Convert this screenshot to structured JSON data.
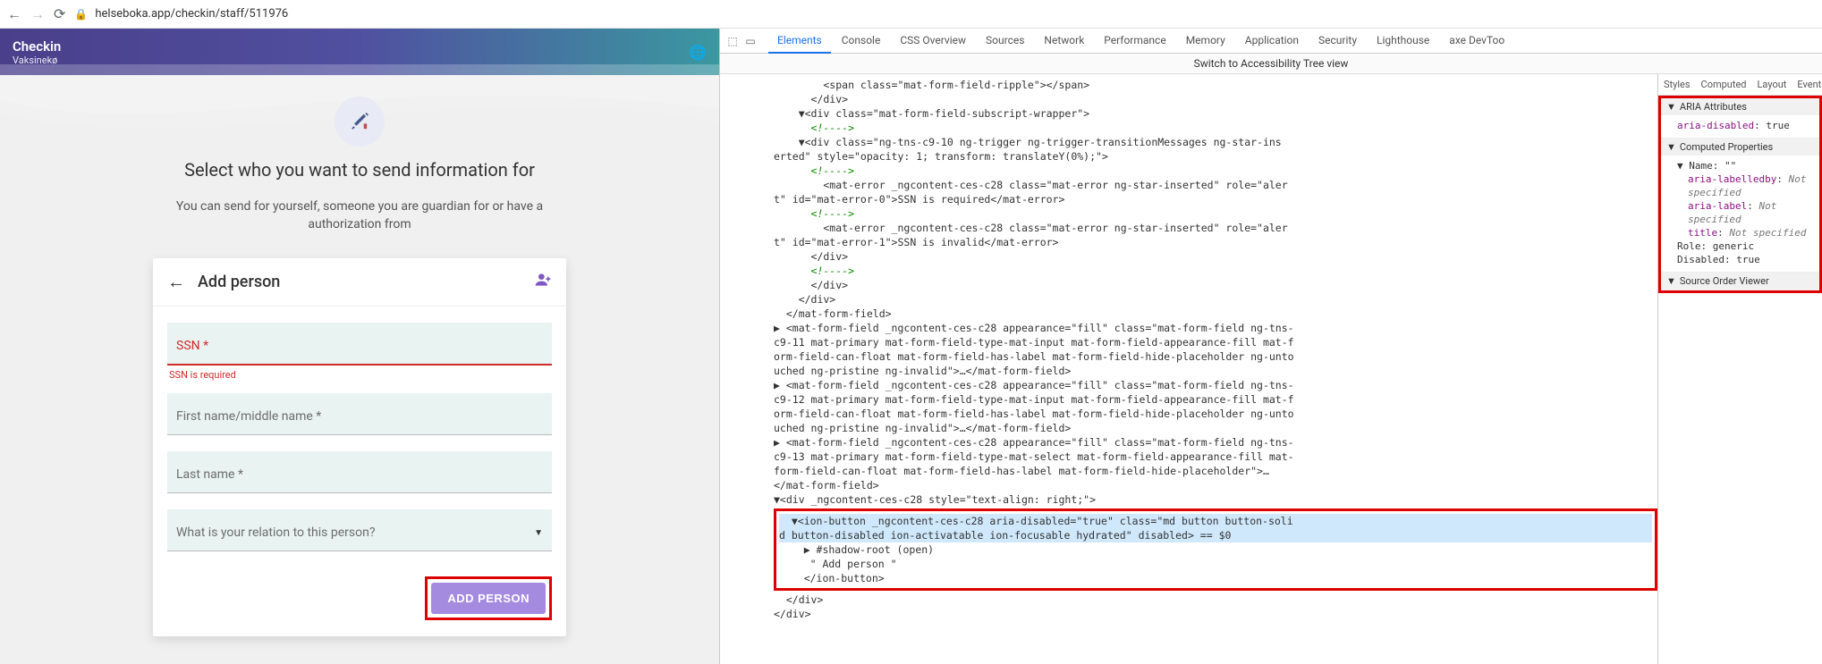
{
  "browser": {
    "url": "helseboka.app/checkin/staff/511976"
  },
  "app": {
    "brand": "Checkin",
    "sub": "Vaksinekø",
    "heading": "Select who you want to send information for",
    "subheading": "You can send for yourself, someone you are guardian for or have a authorization from"
  },
  "modal": {
    "title": "Add person",
    "ssn_label": "SSN *",
    "ssn_error": "SSN is required",
    "first_label": "First name/middle name *",
    "last_label": "Last name *",
    "relation_label": "What is your relation to this person?",
    "button": "ADD PERSON"
  },
  "devtools": {
    "tabs": [
      "Elements",
      "Console",
      "CSS Overview",
      "Sources",
      "Network",
      "Performance",
      "Memory",
      "Application",
      "Security",
      "Lighthouse",
      "axe DevToo"
    ],
    "active_tab": "Elements",
    "acc_switch": "Switch to Accessibility Tree view",
    "side_tabs": [
      "Styles",
      "Computed",
      "Layout",
      "Event"
    ],
    "aria_section": "ARIA Attributes",
    "aria": {
      "aria_disabled": "true"
    },
    "computed_section": "Computed Properties",
    "name_label": "Name: \"\"",
    "labelledby": "Not specified",
    "ariaLabel": "Not specified",
    "title": "Not specified",
    "role": "generic",
    "disabled": "true",
    "source_order": "Source Order Viewer",
    "tree": {
      "l1": "        <span class=\"mat-form-field-ripple\"></span>",
      "l2": "      </div>",
      "l3": "    ▼<div class=\"mat-form-field-subscript-wrapper\">",
      "l4": "      <!---->",
      "l5": "    ▼<div class=\"ng-tns-c9-10 ng-trigger ng-trigger-transitionMessages ng-star-ins",
      "l5b": "erted\" style=\"opacity: 1; transform: translateY(0%);\">",
      "l6": "      <!---->",
      "l7": "        <mat-error _ngcontent-ces-c28 class=\"mat-error ng-star-inserted\" role=\"aler",
      "l7b": "t\" id=\"mat-error-0\">SSN is required</mat-error>",
      "l8": "      <!---->",
      "l9": "        <mat-error _ngcontent-ces-c28 class=\"mat-error ng-star-inserted\" role=\"aler",
      "l9b": "t\" id=\"mat-error-1\">SSN is invalid</mat-error>",
      "l10": "      </div>",
      "l11": "      <!---->",
      "l12": "      </div>",
      "l13": "    </div>",
      "l14": "  </mat-form-field>",
      "l15": "▶ <mat-form-field _ngcontent-ces-c28 appearance=\"fill\" class=\"mat-form-field ng-tns-",
      "l15b": "c9-11 mat-primary mat-form-field-type-mat-input mat-form-field-appearance-fill mat-f",
      "l15c": "orm-field-can-float mat-form-field-has-label mat-form-field-hide-placeholder ng-unto",
      "l15d": "uched ng-pristine ng-invalid\">…</mat-form-field>",
      "l16": "▶ <mat-form-field _ngcontent-ces-c28 appearance=\"fill\" class=\"mat-form-field ng-tns-",
      "l16b": "c9-12 mat-primary mat-form-field-type-mat-input mat-form-field-appearance-fill mat-f",
      "l16c": "orm-field-can-float mat-form-field-has-label mat-form-field-hide-placeholder ng-unto",
      "l16d": "uched ng-pristine ng-invalid\">…</mat-form-field>",
      "l17": "▶ <mat-form-field _ngcontent-ces-c28 appearance=\"fill\" class=\"mat-form-field ng-tns-",
      "l17b": "c9-13 mat-primary mat-form-field-type-mat-select mat-form-field-appearance-fill mat-",
      "l17c": "form-field-can-float mat-form-field-has-label mat-form-field-hide-placeholder\">…",
      "l17d": "</mat-form-field>",
      "l18": "▼<div _ngcontent-ces-c28 style=\"text-align: right;\">",
      "l19": "  ▼<ion-button _ngcontent-ces-c28 aria-disabled=\"true\" class=\"md button button-soli",
      "l19b": "d button-disabled ion-activatable ion-focusable hydrated\" disabled> == $0",
      "l20": "    ▶ #shadow-root (open)",
      "l21": "     \" Add person \"",
      "l22": "    </ion-button>",
      "l23": "  </div>",
      "l24": "</div>"
    }
  }
}
